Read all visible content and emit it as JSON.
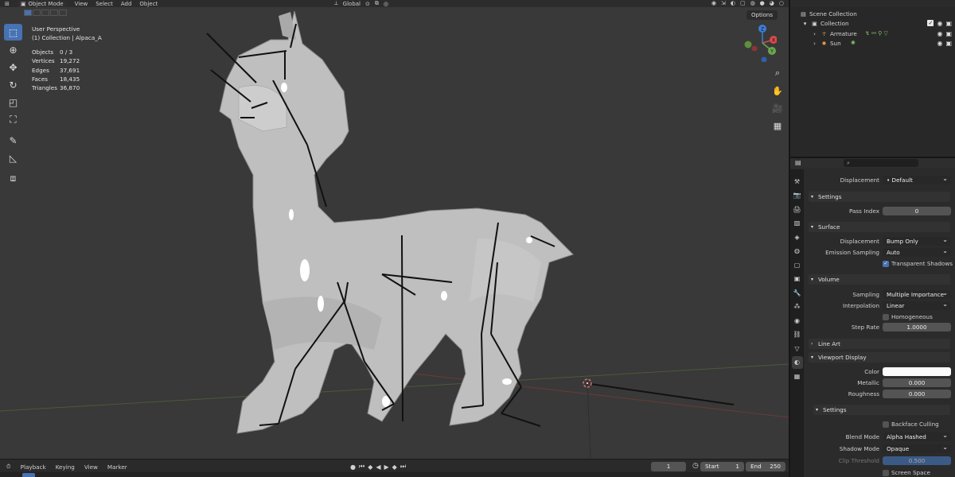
{
  "header": {
    "mode": "Object Mode",
    "menus": [
      "View",
      "Select",
      "Add",
      "Object"
    ],
    "transform": "Global"
  },
  "viewport": {
    "options": "Options",
    "perspective": "User Perspective",
    "collection_line": "(1) Collection | Alpaca_A",
    "stats": [
      {
        "key": "Objects",
        "value": "0 / 3"
      },
      {
        "key": "Vertices",
        "value": "19,272"
      },
      {
        "key": "Edges",
        "value": "37,691"
      },
      {
        "key": "Faces",
        "value": "18,435"
      },
      {
        "key": "Triangles",
        "value": "36,870"
      }
    ],
    "gizmo": {
      "x": "X",
      "y": "Y",
      "z": "Z"
    }
  },
  "timeline": {
    "menus": [
      "Playback",
      "Keying",
      "View",
      "Marker"
    ],
    "current_frame": "1",
    "start_label": "Start",
    "start_value": "1",
    "end_label": "End",
    "end_value": "250"
  },
  "outliner": {
    "items": [
      {
        "label": "Scene Collection"
      },
      {
        "label": "Collection"
      },
      {
        "label": "Armature"
      },
      {
        "label": "Sun"
      }
    ]
  },
  "properties": {
    "displacement_label": "Displacement",
    "displacement_value": "Default",
    "settings_head": "Settings",
    "pass_index_label": "Pass Index",
    "pass_index_value": "0",
    "surface_head": "Surface",
    "surface_displacement_label": "Displacement",
    "surface_displacement_value": "Bump Only",
    "emission_label": "Emission Sampling",
    "emission_value": "Auto",
    "transparent_shadows": "Transparent Shadows",
    "volume_head": "Volume",
    "sampling_label": "Sampling",
    "sampling_value": "Multiple Importance",
    "interp_label": "Interpolation",
    "interp_value": "Linear",
    "homogeneous": "Homogeneous",
    "step_rate_label": "Step Rate",
    "step_rate_value": "1.0000",
    "line_art_head": "Line Art",
    "viewport_display_head": "Viewport Display",
    "color_label": "Color",
    "metallic_label": "Metallic",
    "metallic_value": "0.000",
    "roughness_label": "Roughness",
    "roughness_value": "0.000",
    "settings2_head": "Settings",
    "backface": "Backface Culling",
    "blend_label": "Blend Mode",
    "blend_value": "Alpha Hashed",
    "shadow_label": "Shadow Mode",
    "shadow_value": "Opaque",
    "clip_label": "Clip Threshold",
    "clip_value": "0.500",
    "ssr": "Screen Space Refraction"
  }
}
